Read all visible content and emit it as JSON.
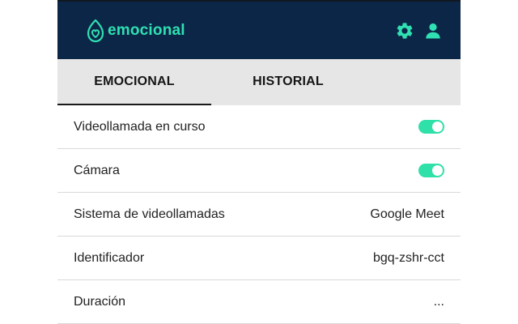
{
  "app": {
    "brand_name": "emocional",
    "accent_color": "#2fe0b2",
    "header_color": "#0c2647"
  },
  "header": {
    "icons": [
      "gear-icon",
      "user-icon"
    ]
  },
  "tabs": [
    {
      "label": "EMOCIONAL",
      "active": true
    },
    {
      "label": "HISTORIAL",
      "active": false
    }
  ],
  "rows": [
    {
      "label": "Videollamada en curso",
      "type": "toggle",
      "on": true
    },
    {
      "label": "Cámara",
      "type": "toggle",
      "on": true
    },
    {
      "label": "Sistema de videollamadas",
      "type": "text",
      "value": "Google Meet"
    },
    {
      "label": "Identificador",
      "type": "text",
      "value": "bgq-zshr-cct"
    },
    {
      "label": "Duración",
      "type": "text",
      "value": "..."
    }
  ]
}
